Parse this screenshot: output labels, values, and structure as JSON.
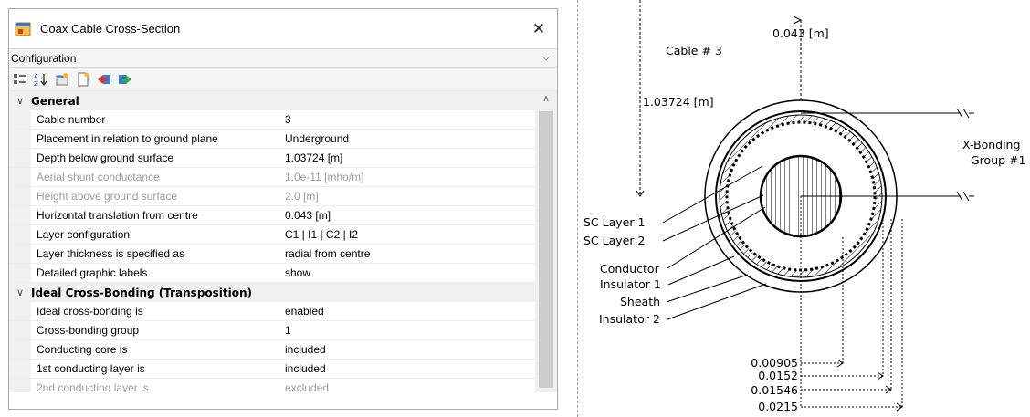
{
  "window": {
    "title": "Coax Cable Cross-Section",
    "close_glyph": "✕",
    "config_label": "Configuration",
    "config_chevron": "⌵"
  },
  "toolbar": {
    "icons": [
      "categorized-icon",
      "alphabetical-sort-icon",
      "property-pages-icon",
      "new-document-icon",
      "import-arrow-icon",
      "export-arrow-icon"
    ]
  },
  "categories": {
    "general": "General",
    "bonding": "Ideal Cross-Bonding (Transposition)"
  },
  "props": [
    {
      "name": "Cable number",
      "value": "3"
    },
    {
      "name": "Placement in relation to ground plane",
      "value": "Underground"
    },
    {
      "name": "Depth below ground surface",
      "value": "1.03724 [m]"
    },
    {
      "name": "Aerial shunt conductance",
      "value": "1.0e-11 [mho/m]"
    },
    {
      "name": "Height above ground surface",
      "value": "2.0 [m]"
    },
    {
      "name": "Horizontal translation from centre",
      "value": "0.043 [m]"
    },
    {
      "name": "Layer configuration",
      "value": "C1 | I1 | C2 | I2"
    },
    {
      "name": "Layer thickness is specified as",
      "value": "radial from centre"
    },
    {
      "name": "Detailed graphic labels",
      "value": "show"
    },
    {
      "name": "Ideal cross-bonding is",
      "value": "enabled"
    },
    {
      "name": "Cross-bonding group",
      "value": "1"
    },
    {
      "name": "Conducting core is",
      "value": "included"
    },
    {
      "name": "1st conducting layer is",
      "value": "included"
    },
    {
      "name": "2nd conducting layer is",
      "value": "excluded"
    }
  ],
  "drawing": {
    "horizontal_offset": "0.043 [m]",
    "cable_label": "Cable # 3",
    "depth": "1.03724 [m]",
    "bonding_label_1": "X-Bonding",
    "bonding_label_2": "Group #1",
    "layer_labels": [
      "SC Layer 1",
      "SC Layer 2",
      "Conductor",
      "Insulator 1",
      "Sheath",
      "Insulator 2"
    ],
    "radii": [
      "0.00905",
      "0.0152",
      "0.01546",
      "0.0215"
    ]
  }
}
